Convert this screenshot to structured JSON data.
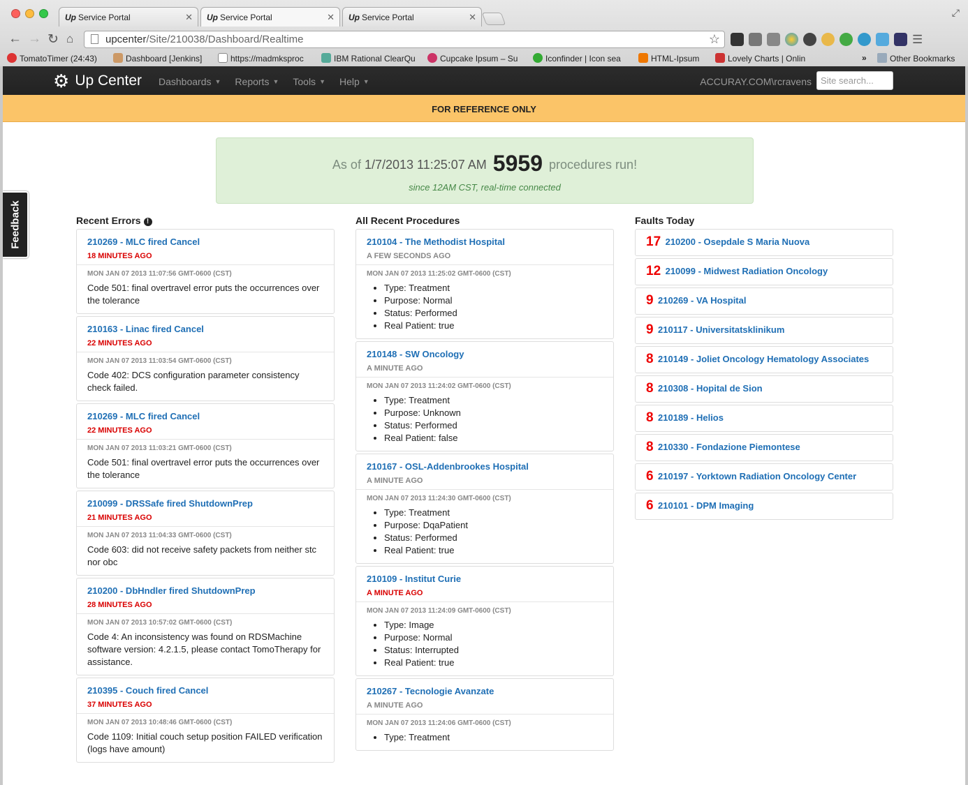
{
  "browser": {
    "tabs": [
      {
        "favicon": "Up",
        "title": "Service Portal"
      },
      {
        "favicon": "Up",
        "title": "Service Portal"
      },
      {
        "favicon": "Up",
        "title": "Service Portal"
      }
    ],
    "url_host": "upcenter",
    "url_path": "/Site/210038/Dashboard/Realtime",
    "bookmarks": [
      {
        "label": "TomatoTimer (24:43)",
        "color": "#d33"
      },
      {
        "label": "Dashboard [Jenkins]",
        "color": "#c96"
      },
      {
        "label": "https://madmksproc",
        "color": "#ddd"
      },
      {
        "label": "IBM Rational ClearQu",
        "color": "#5a9"
      },
      {
        "label": "Cupcake Ipsum – Su",
        "color": "#c36"
      },
      {
        "label": "Iconfinder | Icon sea",
        "color": "#3a3"
      },
      {
        "label": "HTML-Ipsum",
        "color": "#e70"
      },
      {
        "label": "Lovely Charts | Onlin",
        "color": "#c33"
      }
    ],
    "bookmarks_more": "»",
    "other_bookmarks": "Other Bookmarks"
  },
  "app": {
    "brand": "Up Center",
    "nav": [
      "Dashboards",
      "Reports",
      "Tools",
      "Help"
    ],
    "user": "ACCURAY.COM\\rcravens",
    "search_placeholder": "Site search...",
    "banner": "FOR REFERENCE ONLY"
  },
  "summary": {
    "prefix": "As of",
    "datetime": "1/7/2013 11:25:07 AM",
    "count": "5959",
    "suffix": "procedures run!",
    "subtitle": "since 12AM CST, real-time connected"
  },
  "feedback_label": "Feedback",
  "errors": {
    "heading": "Recent Errors",
    "items": [
      {
        "title": "210269 - MLC fired Cancel",
        "ago": "18 MINUTES AGO",
        "date": "MON JAN 07 2013 11:07:56 GMT-0600 (CST)",
        "message": "Code 501: final overtravel error puts the occurrences over the tolerance"
      },
      {
        "title": "210163 - Linac fired Cancel",
        "ago": "22 MINUTES AGO",
        "date": "MON JAN 07 2013 11:03:54 GMT-0600 (CST)",
        "message": "Code 402: DCS configuration parameter consistency check failed."
      },
      {
        "title": "210269 - MLC fired Cancel",
        "ago": "22 MINUTES AGO",
        "date": "MON JAN 07 2013 11:03:21 GMT-0600 (CST)",
        "message": "Code 501: final overtravel error puts the occurrences over the tolerance"
      },
      {
        "title": "210099 - DRSSafe fired ShutdownPrep",
        "ago": "21 MINUTES AGO",
        "date": "MON JAN 07 2013 11:04:33 GMT-0600 (CST)",
        "message": "Code 603: did not receive safety packets from neither stc nor obc"
      },
      {
        "title": "210200 - DbHndler fired ShutdownPrep",
        "ago": "28 MINUTES AGO",
        "date": "MON JAN 07 2013 10:57:02 GMT-0600 (CST)",
        "message": "Code 4: An inconsistency was found on RDSMachine software version: 4.2.1.5, please contact TomoTherapy for assistance."
      },
      {
        "title": "210395 - Couch fired Cancel",
        "ago": "37 MINUTES AGO",
        "date": "MON JAN 07 2013 10:48:46 GMT-0600 (CST)",
        "message": "Code 1109: Initial couch setup position FAILED verification (logs have amount)"
      }
    ]
  },
  "procedures": {
    "heading": "All Recent Procedures",
    "items": [
      {
        "title": "210104 - The Methodist Hospital",
        "ago": "A FEW SECONDS AGO",
        "ago_red": false,
        "date": "MON JAN 07 2013 11:25:02 GMT-0600 (CST)",
        "details": [
          "Type: Treatment",
          "Purpose: Normal",
          "Status: Performed",
          "Real Patient: true"
        ]
      },
      {
        "title": "210148 - SW Oncology",
        "ago": "A MINUTE AGO",
        "ago_red": false,
        "date": "MON JAN 07 2013 11:24:02 GMT-0600 (CST)",
        "details": [
          "Type: Treatment",
          "Purpose: Unknown",
          "Status: Performed",
          "Real Patient: false"
        ]
      },
      {
        "title": "210167 - OSL-Addenbrookes Hospital",
        "ago": "A MINUTE AGO",
        "ago_red": false,
        "date": "MON JAN 07 2013 11:24:30 GMT-0600 (CST)",
        "details": [
          "Type: Treatment",
          "Purpose: DqaPatient",
          "Status: Performed",
          "Real Patient: true"
        ]
      },
      {
        "title": "210109 - Institut Curie",
        "ago": "A MINUTE AGO",
        "ago_red": true,
        "date": "MON JAN 07 2013 11:24:09 GMT-0600 (CST)",
        "details": [
          "Type: Image",
          "Purpose: Normal",
          "Status: Interrupted",
          "Real Patient: true"
        ]
      },
      {
        "title": "210267 - Tecnologie Avanzate",
        "ago": "A MINUTE AGO",
        "ago_red": false,
        "date": "MON JAN 07 2013 11:24:06 GMT-0600 (CST)",
        "details": [
          "Type: Treatment"
        ]
      }
    ]
  },
  "faults": {
    "heading": "Faults Today",
    "items": [
      {
        "count": "17",
        "site": "210200 - Osepdale S Maria Nuova"
      },
      {
        "count": "12",
        "site": "210099 - Midwest Radiation Oncology"
      },
      {
        "count": "9",
        "site": "210269 - VA Hospital"
      },
      {
        "count": "9",
        "site": "210117 - Universitatsklinikum"
      },
      {
        "count": "8",
        "site": "210149 - Joliet Oncology Hematology Associates"
      },
      {
        "count": "8",
        "site": "210308 - Hopital de Sion"
      },
      {
        "count": "8",
        "site": "210189 - Helios"
      },
      {
        "count": "8",
        "site": "210330 - Fondazione Piemontese"
      },
      {
        "count": "6",
        "site": "210197 - Yorktown Radiation Oncology Center"
      },
      {
        "count": "6",
        "site": "210101 - DPM Imaging"
      }
    ]
  }
}
